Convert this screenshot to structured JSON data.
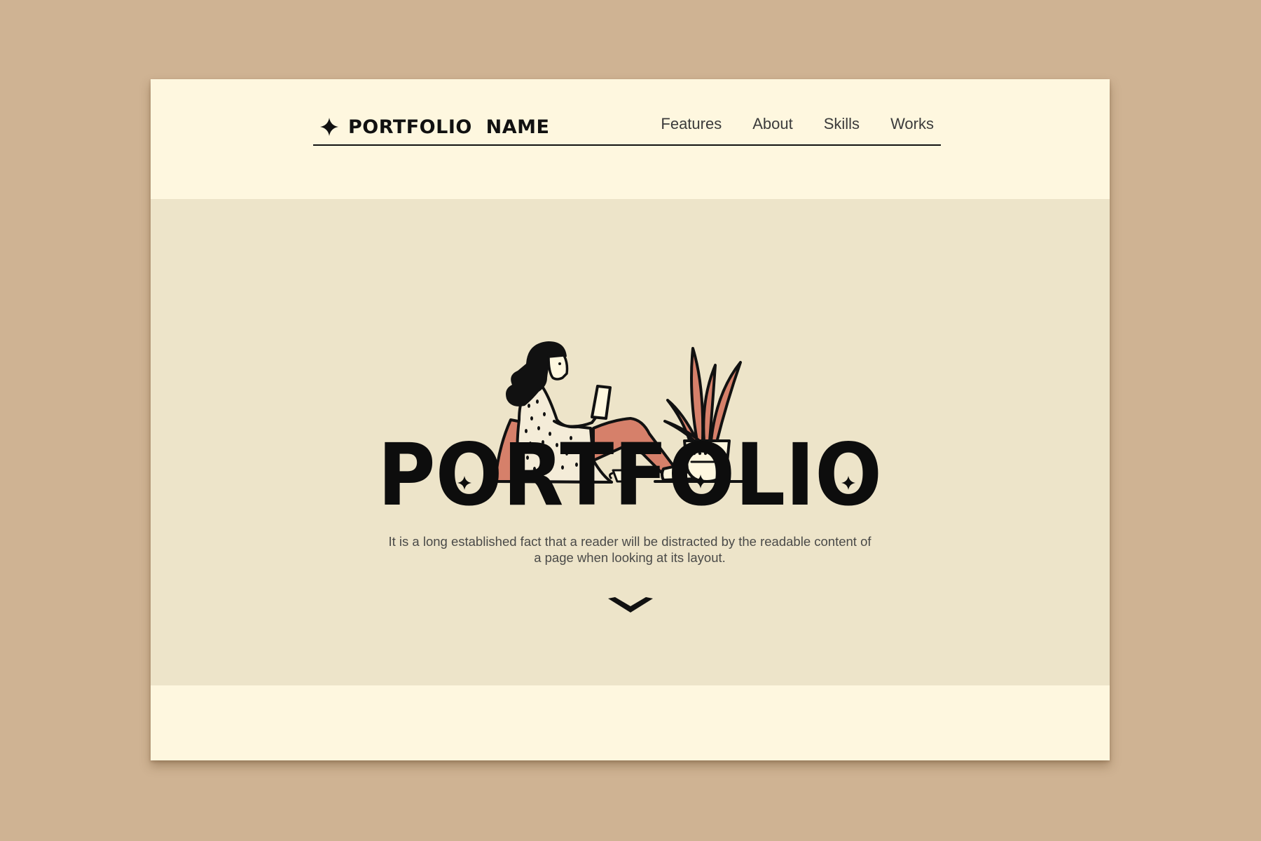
{
  "nav": {
    "brand": "PORTFOLIO  NAME",
    "links": [
      "Features",
      "About",
      "Skills",
      "Works"
    ]
  },
  "hero": {
    "title": "PORTFOLIO",
    "description": "It is a long established fact that a reader will be distracted by the readable content of a page when looking at its layout."
  },
  "icons": {
    "brand": "four-point-star-icon",
    "scroll": "chevron-down-icon",
    "illustration": "woman-reading-with-plant"
  },
  "colors": {
    "backdrop": "#cfb393",
    "page": "#fef7df",
    "hero": "#ede4c9",
    "accent": "#d6806a",
    "ink": "#111111"
  }
}
